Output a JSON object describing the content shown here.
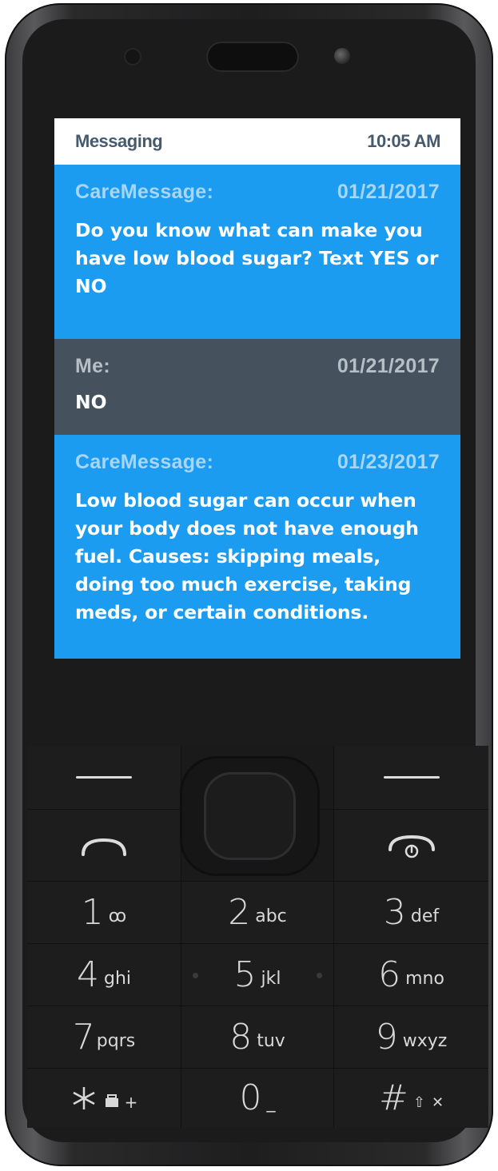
{
  "status_bar": {
    "app_title": "Messaging",
    "time": "10:05 AM"
  },
  "messages": [
    {
      "sender": "CareMessage:",
      "date": "01/21/2017",
      "text": "Do you know what can make you have low blood sugar? Text YES or NO"
    },
    {
      "sender": "Me:",
      "date": "01/21/2017",
      "text": "NO"
    },
    {
      "sender": "CareMessage:",
      "date": "01/23/2017",
      "text": "Low blood sugar can occur when your body does not have enough fuel. Causes: skipping meals, doing too much exercise, taking meds, or certain conditions."
    }
  ],
  "keypad": {
    "keys": [
      {
        "digit": "1",
        "letters": "ꝏ"
      },
      {
        "digit": "2",
        "letters": "abc"
      },
      {
        "digit": "3",
        "letters": "def"
      },
      {
        "digit": "4",
        "letters": "ghi"
      },
      {
        "digit": "5",
        "letters": "jkl"
      },
      {
        "digit": "6",
        "letters": "mno"
      },
      {
        "digit": "7",
        "letters": "pqrs"
      },
      {
        "digit": "8",
        "letters": "tuv"
      },
      {
        "digit": "9",
        "letters": "wxyz"
      },
      {
        "digit": "*",
        "letters": "+"
      },
      {
        "digit": "0",
        "letters": "_"
      },
      {
        "digit": "#",
        "letters": ""
      }
    ],
    "icons": {
      "voicemail": "voicemail-icon",
      "call": "call-icon",
      "end_call": "end-call-icon"
    }
  },
  "colors": {
    "care_bg": "#1c9cf0",
    "me_bg": "#45525e",
    "status_text": "#465a6e"
  }
}
